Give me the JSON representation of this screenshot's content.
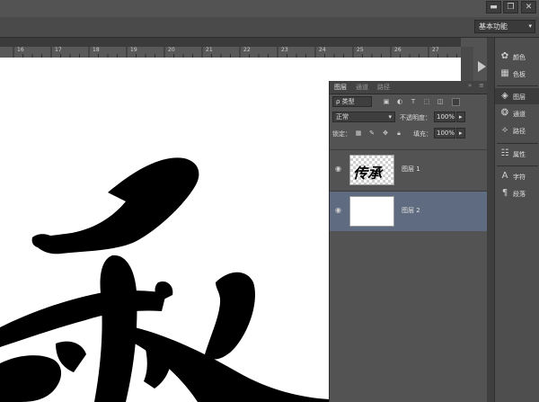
{
  "window_controls": {
    "minimize": "▬",
    "restore": "❐",
    "close": "✕"
  },
  "workspace": {
    "label": "基本功能",
    "caret": "▾"
  },
  "collapse_arrows": "««",
  "ruler": {
    "ticks": [
      "16",
      "17",
      "18",
      "19",
      "20",
      "21",
      "22",
      "23",
      "24",
      "25",
      "26",
      "27"
    ]
  },
  "layers_panel": {
    "tabs": [
      "图层",
      "通道",
      "路径"
    ],
    "menu_glyph": "≡",
    "expand_glyph": "»",
    "filter_label": "ρ 类型",
    "blend_mode": "正常",
    "opacity_label": "不透明度：",
    "opacity_value": "100%",
    "lock_label": "锁定：",
    "fill_label": "填充：",
    "fill_value": "100%",
    "layers": [
      {
        "name": "图层 1",
        "thumb_text": "传承"
      },
      {
        "name": "图层 2"
      }
    ]
  },
  "dock": {
    "items": [
      {
        "label": "颜色",
        "icon": "palette-icon"
      },
      {
        "label": "色板",
        "icon": "grid-icon"
      },
      {
        "label": "图层",
        "icon": "layers-icon"
      },
      {
        "label": "通道",
        "icon": "channels-icon"
      },
      {
        "label": "路径",
        "icon": "paths-icon"
      },
      {
        "label": "属性",
        "icon": "properties-icon"
      },
      {
        "label": "字符",
        "icon": "character-icon"
      },
      {
        "label": "段落",
        "icon": "paragraph-icon"
      }
    ]
  },
  "colors": {
    "selected_layer": "#5f6b80",
    "canvas": "#ffffff"
  }
}
